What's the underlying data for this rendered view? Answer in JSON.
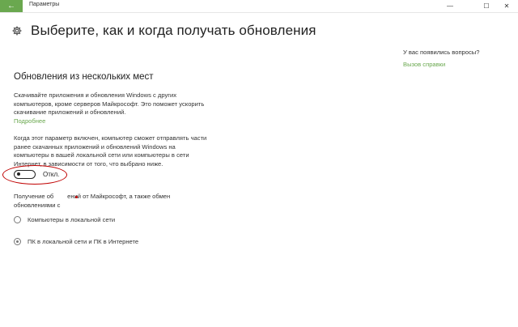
{
  "window": {
    "title": "Параметры",
    "back_icon": "arrow-left-icon",
    "controls": {
      "minimize": "—",
      "maximize": "☐",
      "close": "✕"
    },
    "accent": "#6aa84f"
  },
  "header": {
    "icon": "gear-icon",
    "title": "Выберите, как и когда получать обновления"
  },
  "section": {
    "title": "Обновления из нескольких мест",
    "description": "Скачивайте приложения и обновления Windows с других компьютеров, кроме серверов Майкрософт. Это поможет ускорить скачивание приложений и обновлений.",
    "more_link": "Подробнее",
    "toggle_description": "Когда этот параметр включен, компьютер сможет отправлять части ранее скачанных приложений и обновлений Windows на компьютеры в вашей локальной сети или компьютеры в сети Интернет, в зависимости от того, что выбрано ниже.",
    "toggle": {
      "state": "off",
      "label": "Откл."
    },
    "receive_text_line1": "Получение об        ений от Майкрософт, а также обмен",
    "receive_text_line2": "обновлениями с",
    "options": [
      {
        "label": "Компьютеры в локальной сети",
        "selected": false
      },
      {
        "label": "ПК в локальной сети и ПК в Интернете",
        "selected": true
      }
    ]
  },
  "help": {
    "question": "У вас появились вопросы?",
    "link": "Вызов справки"
  },
  "annotation": {
    "color": "#c00000"
  }
}
